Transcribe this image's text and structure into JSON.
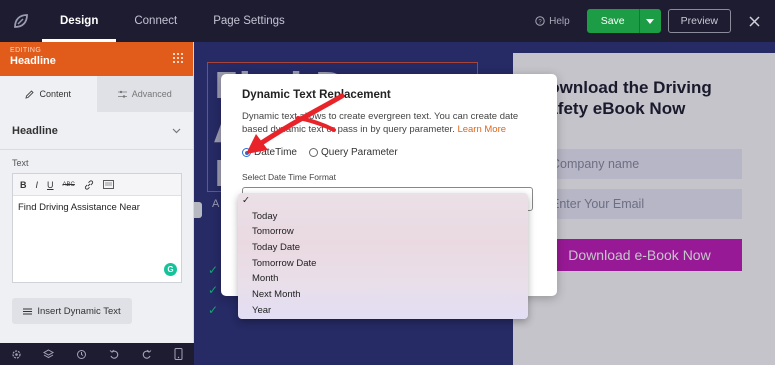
{
  "topbar": {
    "tabs": [
      {
        "label": "Design",
        "active": true
      },
      {
        "label": "Connect",
        "active": false
      },
      {
        "label": "Page Settings",
        "active": false
      }
    ],
    "help_label": "Help",
    "save_label": "Save",
    "preview_label": "Preview"
  },
  "sidebar": {
    "editing_label": "EDITING",
    "editing_title": "Headline",
    "tabs": [
      {
        "label": "Content",
        "active": true
      },
      {
        "label": "Advanced",
        "active": false
      }
    ],
    "section_title": "Headline",
    "text_label": "Text",
    "toolbar": [
      "B",
      "I",
      "U",
      "ABC"
    ],
    "editor_value": "Find Driving Assistance Near",
    "grammarly": "G",
    "insert_label": "Insert Dynamic Text"
  },
  "canvas": {
    "hero_lines": [
      "Find D",
      "A",
      "N"
    ],
    "hero_small": "A",
    "checks": [
      "✓",
      "✓",
      "✓"
    ],
    "form_title": "Download the Driving Safety eBook Now",
    "inputs": [
      "Company name",
      "Enter Your Email"
    ],
    "cta": "Download e-Book Now"
  },
  "modal": {
    "title": "Dynamic Text Replacement",
    "desc": "Dynamic text allows to create evergreen text. You can create date based dynamic text or pass in by query parameter.",
    "link": "Learn More",
    "radio_options": [
      {
        "label": "DateTime",
        "selected": true
      },
      {
        "label": "Query Parameter",
        "selected": false
      }
    ],
    "select_label": "Select Date Time Format",
    "dropdown_options": [
      "✓",
      "Today",
      "Tomorrow",
      "Today Date",
      "Tomorrow Date",
      "Month",
      "Next Month",
      "Year"
    ]
  },
  "colors": {
    "accent_orange": "#e15b1a",
    "save_green": "#1d9c46",
    "cta_magenta": "#c41bb8",
    "arrow_red": "#e8232a"
  }
}
